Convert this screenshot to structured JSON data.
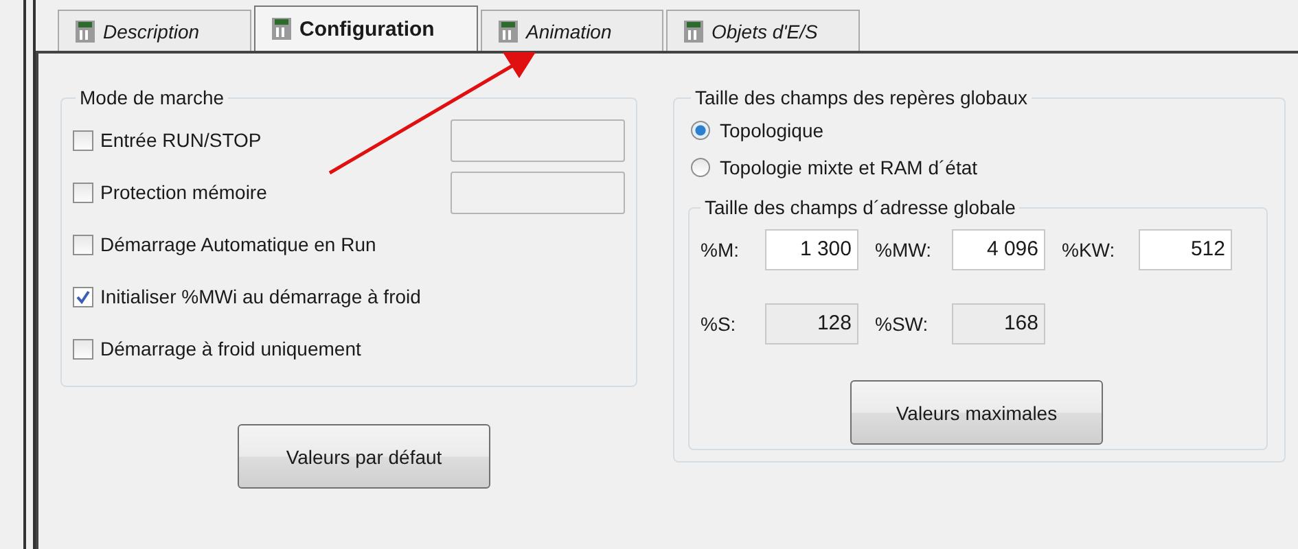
{
  "tabs": [
    {
      "label": "Description",
      "selected": false
    },
    {
      "label": "Configuration",
      "selected": true
    },
    {
      "label": "Animation",
      "selected": false
    },
    {
      "label": "Objets d'E/S",
      "selected": false
    }
  ],
  "mode_de_marche": {
    "title": "Mode de marche",
    "options": [
      {
        "label": "Entrée RUN/STOP",
        "checked": false,
        "field": {
          "disabled": true
        }
      },
      {
        "label": "Protection mémoire",
        "checked": false,
        "field": {
          "disabled": true
        }
      },
      {
        "label": "Démarrage Automatique en Run",
        "checked": false
      },
      {
        "label": "Initialiser %MWi au démarrage à froid",
        "checked": true
      },
      {
        "label": "Démarrage à froid uniquement",
        "checked": false
      }
    ],
    "button": "Valeurs par défaut"
  },
  "taille_reperes": {
    "title": "Taille des champs des repères globaux",
    "radios": [
      {
        "label": "Topologique",
        "selected": true
      },
      {
        "label": "Topologie mixte et RAM d´état",
        "selected": false
      }
    ],
    "adresse": {
      "title": "Taille des champs d´adresse globale",
      "rows": [
        [
          {
            "label": "%M:",
            "value": "1 300",
            "disabled": false
          },
          {
            "label": "%MW:",
            "value": "4 096",
            "disabled": false
          },
          {
            "label": "%KW:",
            "value": "512",
            "disabled": false
          }
        ],
        [
          {
            "label": "%S:",
            "value": "128",
            "disabled": true
          },
          {
            "label": "%SW:",
            "value": "168",
            "disabled": true
          }
        ]
      ],
      "button": "Valeurs maximales"
    }
  }
}
